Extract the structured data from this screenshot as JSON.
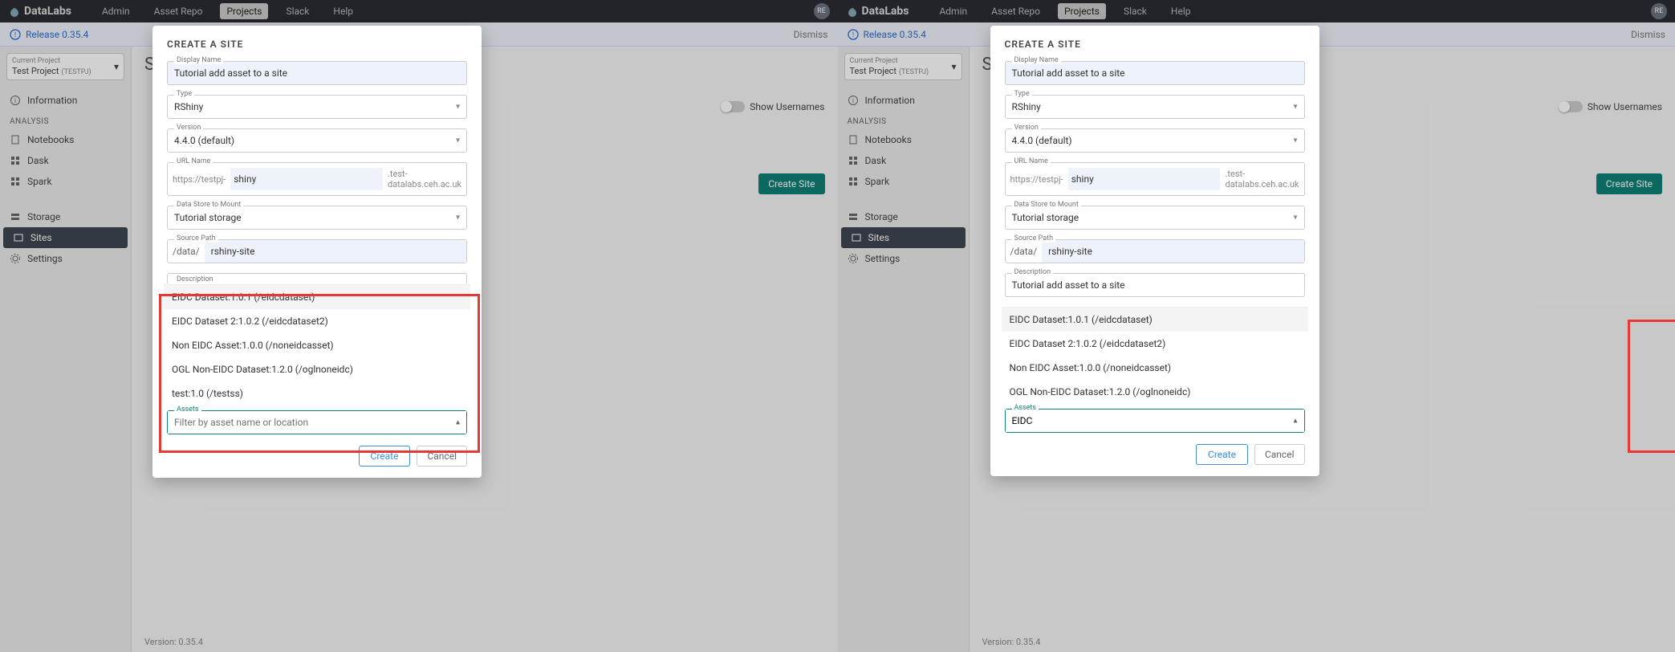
{
  "brand": "DataLabs",
  "nav": {
    "admin": "Admin",
    "asset_repo": "Asset Repo",
    "projects": "Projects",
    "slack": "Slack",
    "help": "Help"
  },
  "user_initials": "RE",
  "banner": {
    "release": "Release 0.35.4",
    "dismiss": "Dismiss"
  },
  "project": {
    "label": "Current Project",
    "name": "Test Project",
    "code": "(TESTPJ)"
  },
  "sidebar": {
    "information": "Information",
    "analysis_head": "ANALYSIS",
    "notebooks": "Notebooks",
    "dask": "Dask",
    "spark": "Spark",
    "storage": "Storage",
    "sites": "Sites",
    "settings": "Settings"
  },
  "page": {
    "title_letter": "S",
    "show_users": "Show Usernames",
    "create_site": "Create Site",
    "footer": "Version: 0.35.4"
  },
  "modal": {
    "title": "CREATE A SITE",
    "display_name_label": "Display Name",
    "display_name": "Tutorial add asset to a site",
    "type_label": "Type",
    "type": "RShiny",
    "version_label": "Version",
    "version": "4.4.0  (default)",
    "url_label": "URL Name",
    "url_prefix": "https://testpj-",
    "url_val": "shiny",
    "url_suffix": ".test-datalabs.ceh.ac.uk",
    "datastore_label": "Data Store to Mount",
    "datastore": "Tutorial storage",
    "srcpath_label": "Source Path",
    "srcpath_prefix": "/data/",
    "srcpath_val": "rshiny-site",
    "description_label": "Description",
    "description": "Tutorial add asset to a site",
    "assets_label": "Assets",
    "assets_placeholder": "Filter by asset name or location",
    "assets_val_right": "EIDC",
    "options": [
      "EIDC Dataset:1.0.1 (/eidcdataset)",
      "EIDC Dataset 2:1.0.2 (/eidcdataset2)",
      "Non EIDC Asset:1.0.0 (/noneidcasset)",
      "OGL Non-EIDC Dataset:1.2.0 (/oglnoneidc)",
      "test:1.0 (/testss)"
    ],
    "filtered_options": [
      "EIDC Dataset:1.0.1 (/eidcdataset)",
      "EIDC Dataset 2:1.0.2 (/eidcdataset2)",
      "Non EIDC Asset:1.0.0 (/noneidcasset)",
      "OGL Non-EIDC Dataset:1.2.0 (/oglnoneidc)"
    ],
    "create": "Create",
    "cancel": "Cancel"
  }
}
